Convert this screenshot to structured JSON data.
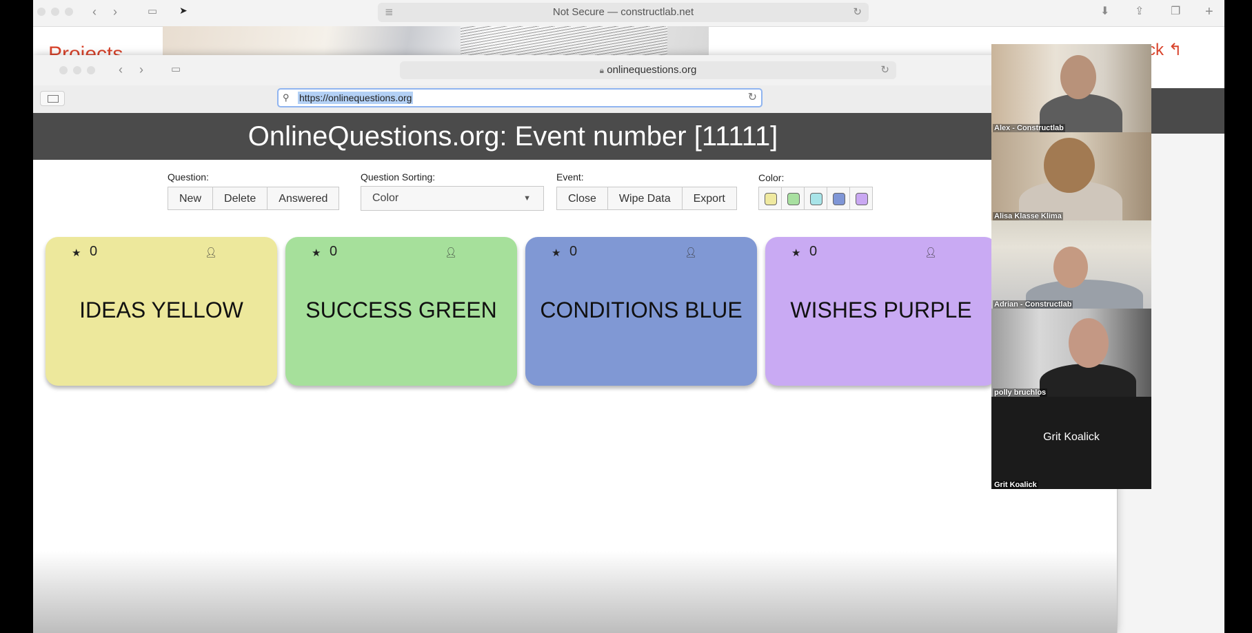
{
  "back_browser": {
    "address": "Not Secure — constructlab.net",
    "page_heading": "Projects",
    "right_text": "ck"
  },
  "front_browser": {
    "domain": "onlinequestions.org",
    "url": "https://onlinequestions.org"
  },
  "app": {
    "title": "OnlineQuestions.org: Event number [11111]",
    "question_label": "Question:",
    "question_buttons": [
      "New",
      "Delete",
      "Answered"
    ],
    "sorting_label": "Question Sorting:",
    "sorting_value": "Color",
    "event_label": "Event:",
    "event_buttons": [
      "Close",
      "Wipe Data",
      "Export"
    ],
    "color_label": "Color:",
    "color_swatches": [
      "#efe9a0",
      "#a8e0a0",
      "#a8e4e8",
      "#7f96d6",
      "#c9a8f2"
    ]
  },
  "cards": [
    {
      "title": "IDEAS YELLOW",
      "count": "0",
      "color": "#ede89c"
    },
    {
      "title": "SUCCESS GREEN",
      "count": "0",
      "color": "#a6e09b"
    },
    {
      "title": "CONDITIONS BLUE",
      "count": "0",
      "color": "#8098d4"
    },
    {
      "title": "WISHES PURPLE",
      "count": "0",
      "color": "#c9aaf3"
    }
  ],
  "participants": [
    {
      "name": "Alex - Constructlab"
    },
    {
      "name": "Alisa Klasse Klima"
    },
    {
      "name": "Adrian - Constructlab"
    },
    {
      "name": "polly bruchlos"
    },
    {
      "name": "Grit Koalick",
      "display": "Grit Koalick"
    }
  ]
}
